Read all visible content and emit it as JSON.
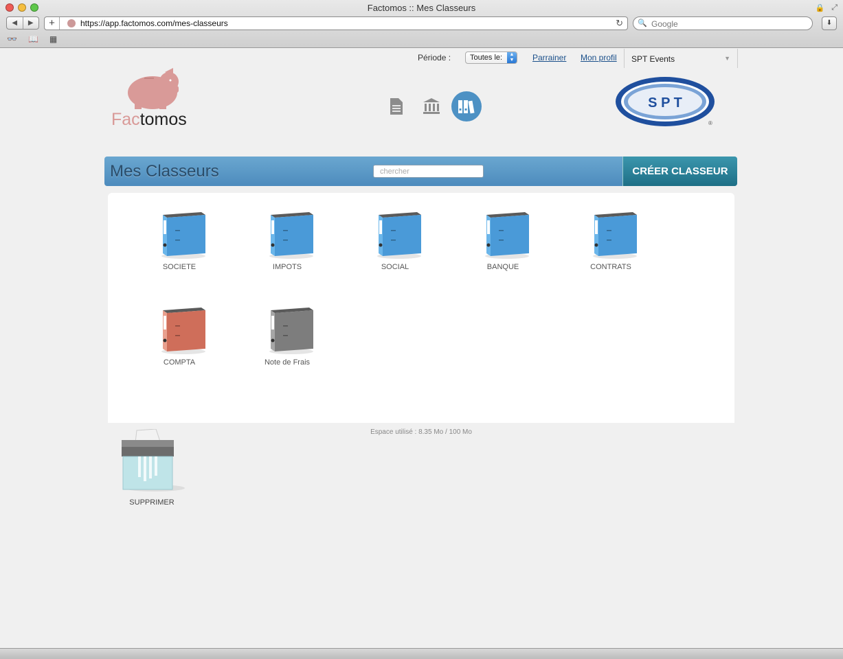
{
  "browser": {
    "title": "Factomos :: Mes Classeurs",
    "url": "https://app.factomos.com/mes-classeurs",
    "search_placeholder": "Google"
  },
  "topnav": {
    "period_label": "Période :",
    "period_value": "Toutes le:",
    "parrainer": "Parrainer",
    "mon_profil": "Mon profil",
    "company": "SPT Events"
  },
  "logo": {
    "fac": "Fac",
    "tomos": "tomos"
  },
  "spt_logo": {
    "letters": "S P T",
    "reg": "®"
  },
  "header": {
    "title": "Mes Classeurs",
    "search_placeholder": "chercher",
    "create_button": "CRÉER CLASSEUR"
  },
  "binders": [
    {
      "label": "SOCIETE",
      "color": "#4a9ad8",
      "spine": "#6bb6ea"
    },
    {
      "label": "IMPOTS",
      "color": "#4a9ad8",
      "spine": "#6bb6ea"
    },
    {
      "label": "SOCIAL",
      "color": "#4a9ad8",
      "spine": "#6bb6ea"
    },
    {
      "label": "BANQUE",
      "color": "#4a9ad8",
      "spine": "#6bb6ea"
    },
    {
      "label": "CONTRATS",
      "color": "#4a9ad8",
      "spine": "#6bb6ea"
    },
    {
      "label": "COMPTA",
      "color": "#cf6e5a",
      "spine": "#e9a08e"
    },
    {
      "label": "Note de Frais",
      "color": "#7d7d7d",
      "spine": "#a6a6a6"
    }
  ],
  "storage": "Espace utilisé : 8.35 Mo / 100 Mo",
  "trash_label": "SUPPRIMER",
  "colors": {
    "accent": "#4d8bbd",
    "create_button": "#2a8299",
    "pig": "#d99a98"
  }
}
